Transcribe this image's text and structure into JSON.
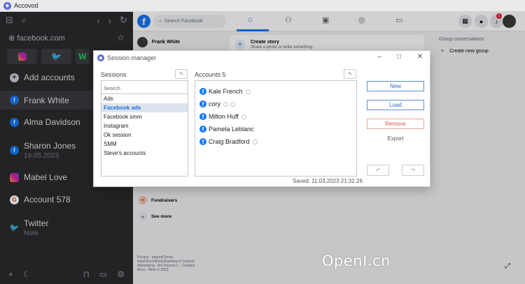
{
  "app": {
    "title": "Accovod"
  },
  "sidebar": {
    "url": "facebook.com",
    "items": [
      {
        "label": "Add accounts",
        "sub": "",
        "icon": "plus-circle-icon"
      },
      {
        "label": "Frank White",
        "sub": "",
        "icon": "facebook-icon"
      },
      {
        "label": "Alma Davidson",
        "sub": "",
        "icon": "facebook-icon"
      },
      {
        "label": "Sharon Jones",
        "sub": "19.05.2023",
        "icon": "facebook-icon"
      },
      {
        "label": "Mabel Love",
        "sub": "",
        "icon": "instagram-icon"
      },
      {
        "label": "Account 578",
        "sub": "",
        "icon": "google-icon"
      },
      {
        "label": "Twitter",
        "sub": "Note",
        "icon": "twitter-icon"
      }
    ]
  },
  "fb": {
    "search_placeholder": "Search Facebook",
    "profile_name": "Frank White",
    "story_title": "Create story",
    "story_sub": "Share a photo or write something.",
    "group_title": "Group conversations",
    "group_new": "Create new group",
    "fundraisers": "Fundraisers",
    "see_more": "See more",
    "footer": [
      "Privacy · Imprint/Terms",
      "NetzDG/UrhDaG/Ranking of Content",
      "Advertising · Ad Choices ▷ · Cookies",
      "More · Meta © 2023"
    ],
    "notification_count": "1"
  },
  "watermark": "OpenI.cn",
  "dialog": {
    "title": "Session manager",
    "sessions_label": "Sessions",
    "accounts_label": "Accounts 5",
    "search_placeholder": "Search",
    "sessions": [
      "Ads",
      "Facebook ads",
      "Facebook smm",
      "Instagram",
      "Ok session",
      "SMM",
      "Steve's accounts"
    ],
    "accounts": [
      {
        "name": "Kale French",
        "eyes": 1
      },
      {
        "name": "cory",
        "eyes": 2
      },
      {
        "name": "Milton Huff",
        "eyes": 1
      },
      {
        "name": "Pamela Leblanc",
        "eyes": 0
      },
      {
        "name": "Craig Bradford",
        "eyes": 1
      }
    ],
    "buttons": {
      "new": "New",
      "load": "Load",
      "remove": "Remove",
      "export": "Export"
    },
    "saved": "Saved: 11.03.2023 21:31:26"
  },
  "colors": {
    "accent": "#1877f2",
    "sidebar_bg": "#2a2b2e",
    "remove": "#d9534f"
  }
}
